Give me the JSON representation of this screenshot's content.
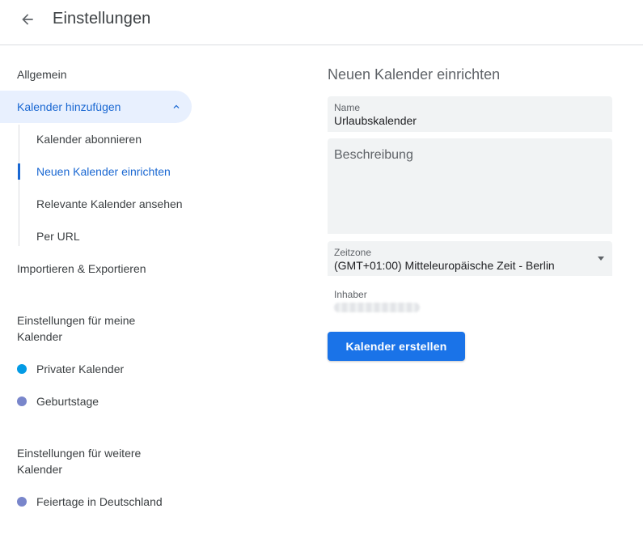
{
  "header": {
    "title": "Einstellungen",
    "back_icon": "arrow-left-icon"
  },
  "sidebar": {
    "general": "Allgemein",
    "add_calendar": {
      "label": "Kalender hinzufügen",
      "expanded": true,
      "icon": "chevron-up-icon",
      "items": [
        {
          "label": "Kalender abonnieren",
          "active": false
        },
        {
          "label": "Neuen Kalender einrichten",
          "active": true
        },
        {
          "label": "Relevante Kalender ansehen",
          "active": false
        },
        {
          "label": "Per URL",
          "active": false
        }
      ]
    },
    "import_export": "Importieren & Exportieren",
    "my_calendars": {
      "heading": "Einstellungen für meine Kalender",
      "items": [
        {
          "label": "Privater Kalender",
          "color": "#039be5"
        },
        {
          "label": "Geburtstage",
          "color": "#7986cb"
        }
      ]
    },
    "other_calendars": {
      "heading": "Einstellungen für weitere Kalender",
      "items": [
        {
          "label": "Feiertage in Deutschland",
          "color": "#7986cb"
        }
      ]
    }
  },
  "main": {
    "title": "Neuen Kalender einrichten",
    "name_field": {
      "label": "Name",
      "value": "Urlaubskalender"
    },
    "description_field": {
      "placeholder": "Beschreibung"
    },
    "timezone_field": {
      "label": "Zeitzone",
      "value": "(GMT+01:00) Mitteleuropäische Zeit - Berlin"
    },
    "owner": {
      "label": "Inhaber"
    },
    "create_button": "Kalender erstellen"
  },
  "colors": {
    "accent": "#1a73e8",
    "active_text": "#1967d2",
    "active_bg": "#e8f0fe"
  }
}
